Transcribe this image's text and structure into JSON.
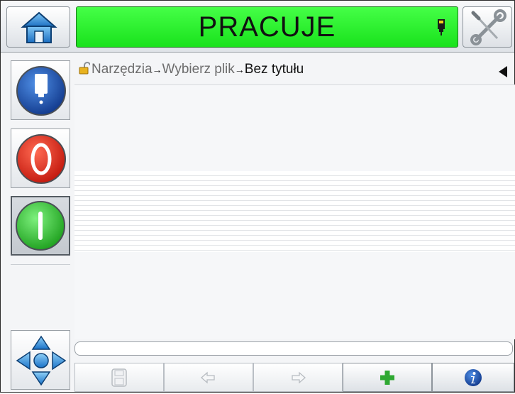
{
  "header": {
    "status_text": "PRACUJE",
    "status_color": "#1fe522",
    "home_icon": "home-icon",
    "ink_icon": "ink-cartridge-icon",
    "tools_icon": "wrench-screwdriver-icon"
  },
  "sidebar": {
    "items": [
      {
        "name": "ink-nozzle-button",
        "icon": "nozzle-icon",
        "color": "#1b55b8"
      },
      {
        "name": "stop-button",
        "icon": "stop-icon",
        "color": "#e8251d"
      },
      {
        "name": "start-button",
        "icon": "start-icon",
        "color": "#2ec22e",
        "active": true
      }
    ],
    "nav_icon": "navigation-arrows-icon"
  },
  "breadcrumb": {
    "items": [
      "Narzędzia",
      "Wybierz plik",
      "Bez tytułu"
    ],
    "separator": "→",
    "lock_icon": "unlocked-padlock-icon",
    "collapse_icon": "triangle-left-icon"
  },
  "editor": {
    "text_value": ""
  },
  "toolbar": {
    "buttons": [
      {
        "name": "save-button",
        "icon": "save-icon",
        "enabled": false
      },
      {
        "name": "undo-button",
        "icon": "undo-icon",
        "enabled": false
      },
      {
        "name": "redo-button",
        "icon": "redo-icon",
        "enabled": false
      },
      {
        "name": "add-button",
        "icon": "plus-icon",
        "enabled": true,
        "color": "#2ea832"
      },
      {
        "name": "info-button",
        "icon": "info-icon",
        "enabled": true,
        "color": "#1b55b8"
      }
    ]
  }
}
